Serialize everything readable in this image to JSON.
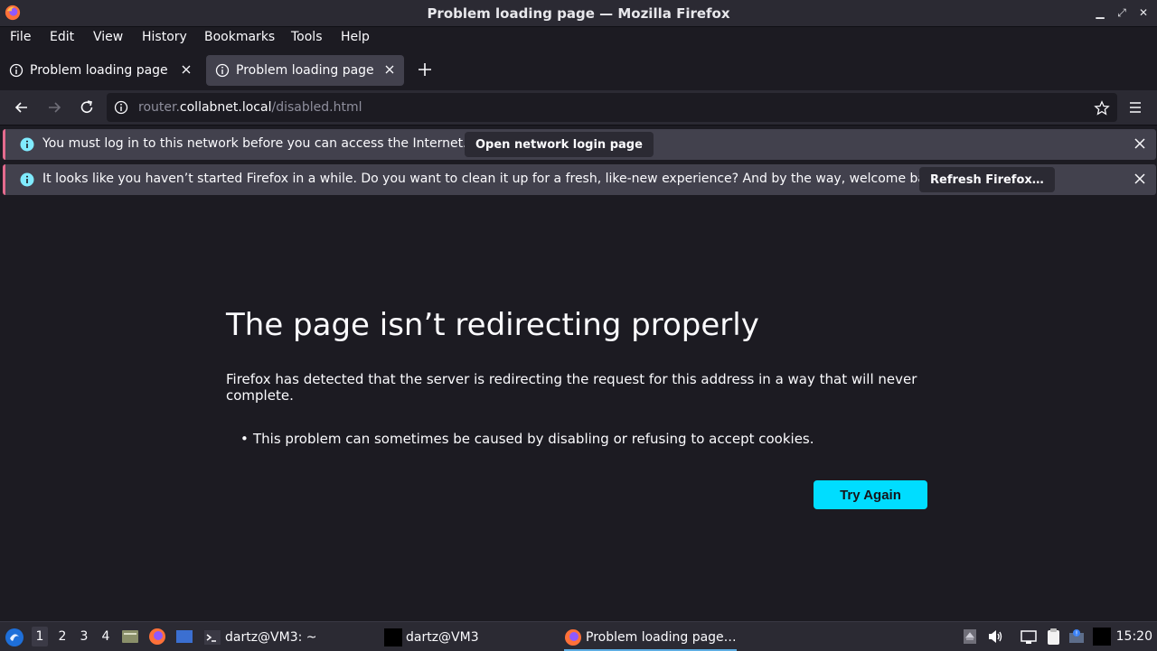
{
  "window": {
    "title": "Problem loading page — Mozilla Firefox"
  },
  "menu": [
    "File",
    "Edit",
    "View",
    "History",
    "Bookmarks",
    "Tools",
    "Help"
  ],
  "tabs": [
    {
      "label": "Problem loading page",
      "active": false
    },
    {
      "label": "Problem loading page",
      "active": true
    }
  ],
  "address": {
    "scheme_host_prefix": "router.",
    "host": "collabnet.local",
    "path": "/disabled.html"
  },
  "notifications": [
    {
      "text": "You must log in to this network before you can access the Internet.",
      "button": "Open network login page"
    },
    {
      "text": "It looks like you haven’t started Firefox in a while. Do you want to clean it up for a fresh, like-new experience? And by the way, welcome back!",
      "button": "Refresh Firefox…"
    }
  ],
  "error": {
    "title": "The page isn’t redirecting properly",
    "description": "Firefox has detected that the server is redirecting the request for this address in a way that will never complete.",
    "items": [
      "This problem can sometimes be caused by disabling or refusing to accept cookies."
    ],
    "button": "Try Again"
  },
  "taskbar": {
    "workspaces": [
      "1",
      "2",
      "3",
      "4"
    ],
    "tasks": [
      {
        "label": "dartz@VM3: ~"
      },
      {
        "label": "dartz@VM3"
      },
      {
        "label": "Problem loading page…",
        "active": true
      }
    ],
    "clock": "15:20"
  },
  "colors": {
    "accent": "#00ddff",
    "notification_border": "#e46b8e",
    "background": "#1c1b22"
  }
}
